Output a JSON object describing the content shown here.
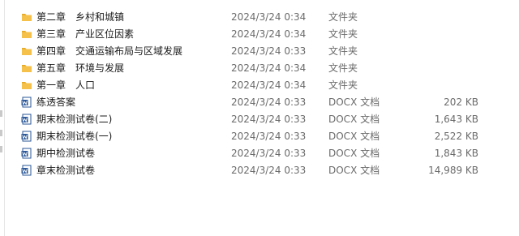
{
  "files": [
    {
      "name": "第二章　乡村和城镇",
      "date": "2024/3/24 0:34",
      "type": "文件夹",
      "size": "",
      "icon": "folder-icon"
    },
    {
      "name": "第三章　产业区位因素",
      "date": "2024/3/24 0:34",
      "type": "文件夹",
      "size": "",
      "icon": "folder-icon"
    },
    {
      "name": "第四章　交通运输布局与区域发展",
      "date": "2024/3/24 0:33",
      "type": "文件夹",
      "size": "",
      "icon": "folder-icon"
    },
    {
      "name": "第五章　环境与发展",
      "date": "2024/3/24 0:34",
      "type": "文件夹",
      "size": "",
      "icon": "folder-icon"
    },
    {
      "name": "第一章　人口",
      "date": "2024/3/24 0:34",
      "type": "文件夹",
      "size": "",
      "icon": "folder-icon"
    },
    {
      "name": "练透答案",
      "date": "2024/3/24 0:33",
      "type": "DOCX 文档",
      "size": "202 KB",
      "icon": "word-doc-icon"
    },
    {
      "name": "期末检测试卷(二)",
      "date": "2024/3/24 0:33",
      "type": "DOCX 文档",
      "size": "1,643 KB",
      "icon": "word-doc-icon"
    },
    {
      "name": "期末检测试卷(一)",
      "date": "2024/3/24 0:33",
      "type": "DOCX 文档",
      "size": "2,522 KB",
      "icon": "word-doc-icon"
    },
    {
      "name": "期中检测试卷",
      "date": "2024/3/24 0:33",
      "type": "DOCX 文档",
      "size": "1,843 KB",
      "icon": "word-doc-icon"
    },
    {
      "name": "章末检测试卷",
      "date": "2024/3/24 0:33",
      "type": "DOCX 文档",
      "size": "14,989 KB",
      "icon": "word-doc-icon"
    }
  ],
  "colors": {
    "folder": "#f5c14b",
    "folder_tab": "#e5a825",
    "word_blue": "#2b5797"
  }
}
